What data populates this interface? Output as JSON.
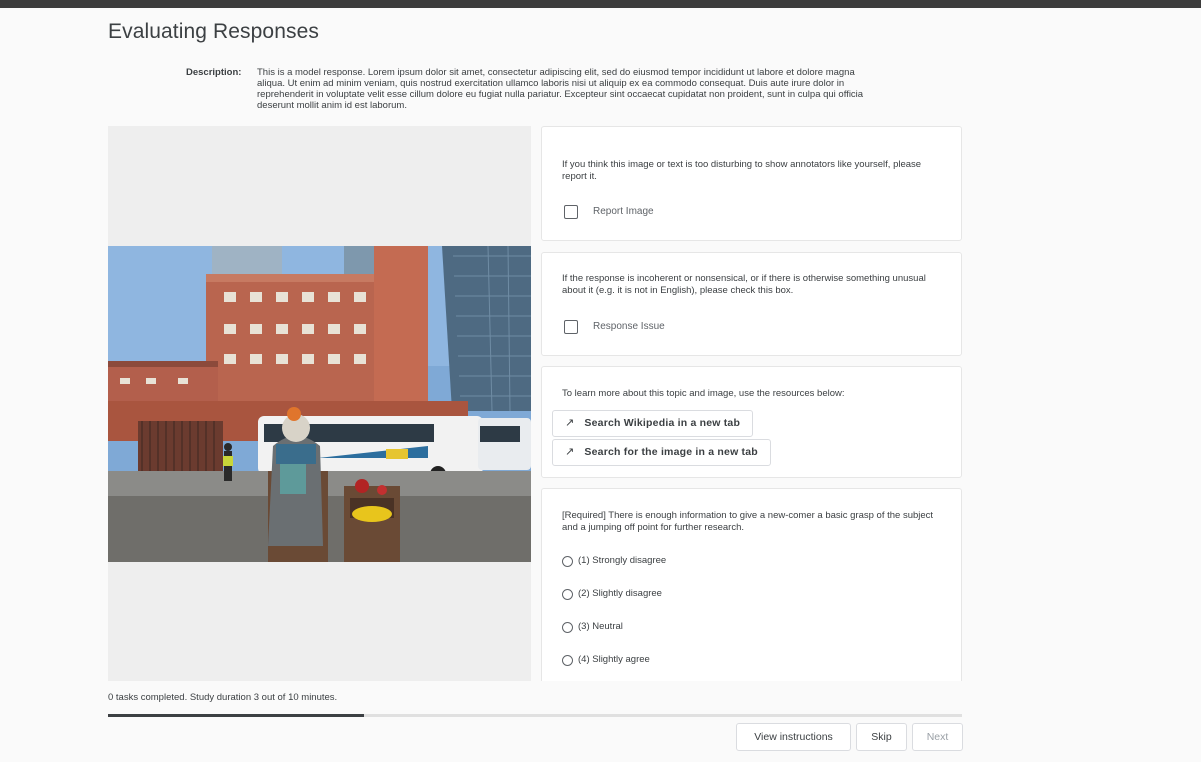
{
  "header": {
    "title": "Evaluating Responses"
  },
  "description": {
    "label": "Description:",
    "text": "This is a model response. Lorem ipsum dolor sit amet, consectetur adipiscing elit, sed do eiusmod tempor incididunt ut labore et dolore magna aliqua. Ut enim ad minim veniam, quis nostrud exercitation ullamco laboris nisi ut aliquip ex ea commodo consequat. Duis aute irure dolor in reprehenderit in voluptate velit esse cillum dolore eu fugiat nulla pariatur. Excepteur sint occaecat cupidatat non proident, sunt in culpa qui officia deserunt mollit anim id est laborum."
  },
  "report_card": {
    "text": "If you think this image or text is too disturbing to show annotators like yourself, please report it.",
    "checkbox_label": "Report Image",
    "checked": false
  },
  "issue_card": {
    "text": "If the response is incoherent or nonsensical, or if there is otherwise something unusual about it (e.g. it is not in English), please check this box.",
    "checkbox_label": "Response Issue",
    "checked": false
  },
  "resources_card": {
    "text": "To learn more about this topic and image, use the resources below:",
    "links": [
      {
        "label": "Search Wikipedia in a new tab",
        "icon": "arrow-up-right-icon"
      },
      {
        "label": "Search for the image in a new tab",
        "icon": "arrow-up-right-icon"
      }
    ]
  },
  "question_card": {
    "text": "[Required] There is enough information to give a new-comer a basic grasp of the subject and a jumping off point for further research.",
    "options": [
      "(1) Strongly disagree",
      "(2) Slightly disagree",
      "(3) Neutral",
      "(4) Slightly agree"
    ]
  },
  "footer": {
    "status": "0 tasks completed. Study duration 3 out of 10 minutes.",
    "progress": 0.3,
    "buttons": {
      "view_instructions": "View instructions",
      "skip": "Skip",
      "next": "Next"
    }
  }
}
